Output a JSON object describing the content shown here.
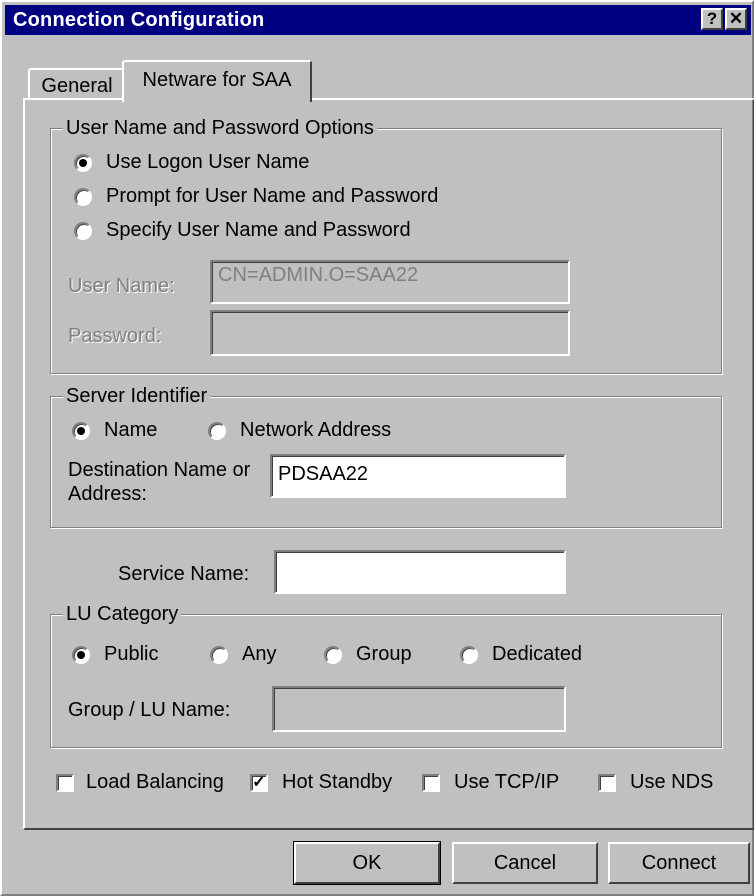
{
  "window": {
    "title": "Connection Configuration",
    "help_button": "?",
    "close_button": "✕"
  },
  "tabs": [
    {
      "label": "General",
      "active": false
    },
    {
      "label": "Netware for SAA",
      "active": true
    }
  ],
  "user_options": {
    "legend": "User Name and Password Options",
    "radios": [
      {
        "label": "Use Logon User Name",
        "checked": true
      },
      {
        "label": "Prompt for User Name and Password",
        "checked": false
      },
      {
        "label": "Specify User Name and Password",
        "checked": false
      }
    ],
    "user_name_label": "User Name:",
    "user_name_value": "CN=ADMIN.O=SAA22",
    "password_label": "Password:",
    "password_value": ""
  },
  "server_identifier": {
    "legend": "Server Identifier",
    "radios": [
      {
        "label": "Name",
        "checked": true
      },
      {
        "label": "Network Address",
        "checked": false
      }
    ],
    "dest_label_line1": "Destination Name or",
    "dest_label_line2": "Address:",
    "dest_value": "PDSAA22"
  },
  "service": {
    "label": "Service Name:",
    "value": ""
  },
  "lu_category": {
    "legend": "LU Category",
    "radios": [
      {
        "label": "Public",
        "checked": true
      },
      {
        "label": "Any",
        "checked": false
      },
      {
        "label": "Group",
        "checked": false
      },
      {
        "label": "Dedicated",
        "checked": false
      }
    ],
    "group_label": "Group / LU Name:",
    "group_value": ""
  },
  "checkboxes": [
    {
      "label": "Load Balancing",
      "checked": false
    },
    {
      "label": "Hot Standby",
      "checked": true
    },
    {
      "label": "Use TCP/IP",
      "checked": false
    },
    {
      "label": "Use NDS",
      "checked": false
    }
  ],
  "buttons": {
    "ok": "OK",
    "cancel": "Cancel",
    "connect": "Connect"
  },
  "check_mark": "✓"
}
